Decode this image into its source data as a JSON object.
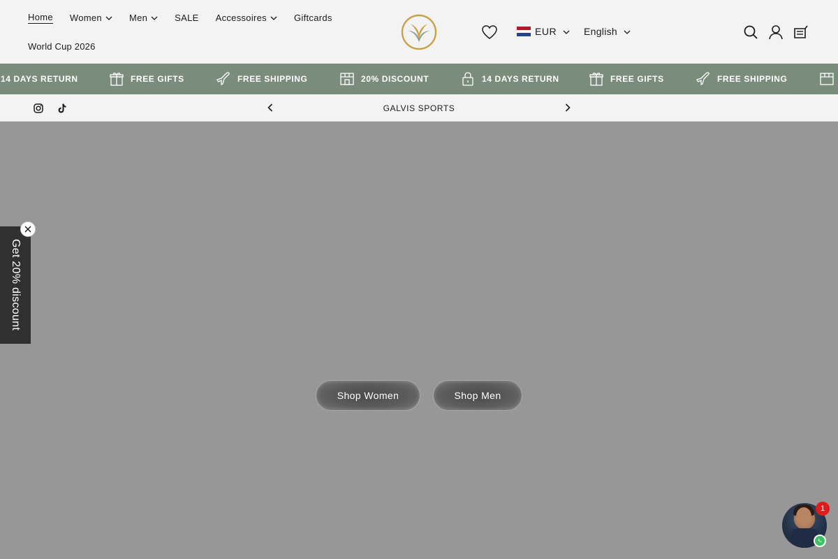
{
  "nav": {
    "items": [
      {
        "label": "Home",
        "dropdown": false,
        "active": true
      },
      {
        "label": "Women",
        "dropdown": true,
        "active": false
      },
      {
        "label": "Men",
        "dropdown": true,
        "active": false
      },
      {
        "label": "SALE",
        "dropdown": false,
        "active": false
      },
      {
        "label": "Accessoires",
        "dropdown": true,
        "active": false
      },
      {
        "label": "Giftcards",
        "dropdown": false,
        "active": false
      }
    ],
    "second_row": "World Cup 2026"
  },
  "header": {
    "currency": "EUR",
    "language": "English",
    "icons": [
      "heart-icon",
      "search-icon",
      "account-icon",
      "cart-icon"
    ],
    "flag_colors": [
      "#ae1c28",
      "#ffffff",
      "#21468b"
    ],
    "logo_colors": [
      "#c9a24a",
      "#6f8a72"
    ]
  },
  "announcement": {
    "items": [
      "14 DAYS RETURN",
      "FREE GIFTS",
      "FREE SHIPPING",
      "20% DISCOUNT",
      "14 DAYS RETURN",
      "FREE GIFTS",
      "FREE SHIPPING"
    ],
    "icons": [
      "lock-icon",
      "gift-icon",
      "plane-icon",
      "store-icon"
    ],
    "bg_color": "#7a8c7c"
  },
  "subbar": {
    "slide_text": "GALVIS SPORTS",
    "socials": [
      "instagram-icon",
      "tiktok-icon"
    ]
  },
  "hero": {
    "buttons": [
      "Shop Women",
      "Shop Men"
    ],
    "bg_color": "#979797"
  },
  "discount_tab": {
    "label": "Get 20% discount"
  },
  "chat": {
    "badge_count": "1"
  }
}
